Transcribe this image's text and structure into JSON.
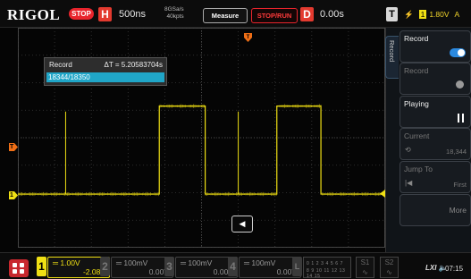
{
  "top_bar": {
    "brand": "RIGOL",
    "run_state": "STOP",
    "horizontal_letter": "H",
    "timebase": "500ns",
    "sample_rate": "8GSa/s",
    "memory_depth": "40kpts",
    "measure_label": "Measure",
    "stop_run_label": "STOP/RUN",
    "delay_letter": "D",
    "delay_value": "0.00s",
    "trigger_letter": "T",
    "trigger_channel": "1",
    "trigger_level": "1.80V",
    "trigger_mode": "A"
  },
  "record_popup": {
    "title": "Record",
    "delta_t": "ΔT = 5.20583704s",
    "frame": "18344/18350"
  },
  "markers": {
    "channel_marker": "1",
    "trigger_level_marker": "T"
  },
  "nav_button_glyph": "◀",
  "right_panel": {
    "tab_label": "Record",
    "items": [
      {
        "label": "Record",
        "state": "on"
      },
      {
        "label": "Record",
        "state": "disabled"
      },
      {
        "label": "Playing",
        "state": "paused"
      },
      {
        "label": "Current",
        "value": "18,344"
      },
      {
        "label": "Jump To",
        "value": "First"
      },
      {
        "label": "More",
        "value": ""
      }
    ]
  },
  "channels": [
    {
      "num": "1",
      "scale": "1.00V",
      "offset": "-2.08V"
    },
    {
      "num": "2",
      "scale": "100mV",
      "offset": "0.00V"
    },
    {
      "num": "3",
      "scale": "100mV",
      "offset": "0.00V"
    },
    {
      "num": "4",
      "scale": "100mV",
      "offset": "0.00V"
    }
  ],
  "logic": {
    "label": "L",
    "row1": "0 1 2 3 4 5 6 7",
    "row2": "8 9 10 11 12 13 14 15"
  },
  "status": {
    "time": "07:15"
  },
  "colors": {
    "ch1": "#f0e014",
    "accent_red": "#e33a2f",
    "record_bar": "#20a6c8",
    "toggle_on": "#2b8ae0"
  },
  "waveform": {
    "channel": "1",
    "shape": "square",
    "low_divisions_from_top": 6.05,
    "high_divisions_from_top": 2.85,
    "rising_edges_div": [
      3.85,
      7.05
    ],
    "falling_edges_div": [
      5.1,
      8.25
    ],
    "spike_divisions": [
      1.3,
      6.0
    ]
  }
}
